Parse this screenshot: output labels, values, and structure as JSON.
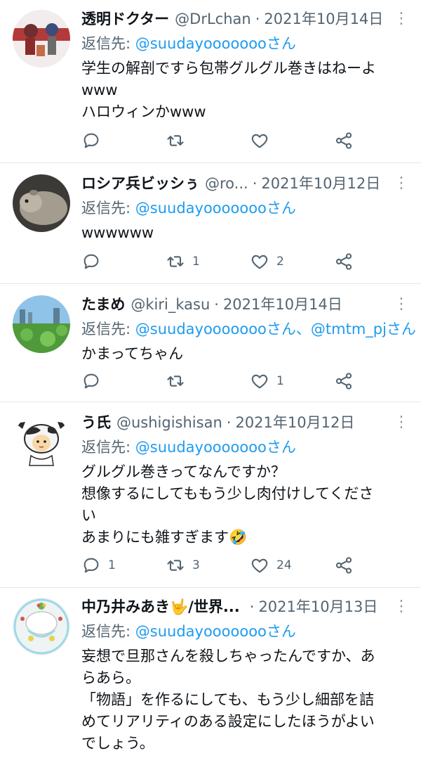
{
  "tweets": [
    {
      "name": "透明ドクター",
      "handle": "@DrLchan",
      "date": "2021年10月14日",
      "reply_prefix": "返信先: ",
      "reply_to": "@suudayoooooooさん",
      "body": "学生の解剖ですら包帯グルグル巻きはねーよ\nwww\nハロウィンかwww",
      "counts": {
        "reply": "",
        "retweet": "",
        "like": ""
      },
      "avatar": "avatar-image"
    },
    {
      "name": "ロシア兵ビッシぅ",
      "handle": "@ro...",
      "date": "2021年10月12日",
      "reply_prefix": "返信先: ",
      "reply_to": "@suudayoooooooさん",
      "body": "wwwwww",
      "counts": {
        "reply": "",
        "retweet": "1",
        "like": "2"
      },
      "avatar": "avatar-image"
    },
    {
      "name": "たまめ",
      "handle": "@kiri_kasu",
      "date": "2021年10月14日",
      "reply_prefix": "返信先: ",
      "reply_to": "@suudayoooooooさん、@tmtm_pjさん",
      "body": "かまってちゃん",
      "counts": {
        "reply": "",
        "retweet": "",
        "like": "1"
      },
      "avatar": "avatar-image"
    },
    {
      "name": "う氏",
      "handle": "@ushigishisan",
      "date": "2021年10月12日",
      "reply_prefix": "返信先: ",
      "reply_to": "@suudayoooooooさん",
      "body": "グルグル巻きってなんですか？\n想像するにしてももう少し肉付けしてくださ\nい\nあまりにも雑すぎます🤣",
      "counts": {
        "reply": "1",
        "retweet": "3",
        "like": "24"
      },
      "avatar": "avatar-image"
    },
    {
      "name": "中乃井みあき🤟/世界...",
      "handle": "",
      "date": "2021年10月13日",
      "reply_prefix": "返信先: ",
      "reply_to": "@suudayoooooooさん",
      "body": "妄想で旦那さんを殺しちゃったんですか、あ\nらあら。\n「物語」を作るにしても、もう少し細部を詰\nめてリアリティのある設定にしたほうがよい\nでしょう。",
      "counts": {
        "reply": "",
        "retweet": "",
        "like": ""
      },
      "avatar": "avatar-image"
    }
  ],
  "icons": {
    "more": "more-options-icon",
    "reply": "reply-icon",
    "retweet": "retweet-icon",
    "like": "like-icon",
    "share": "share-icon"
  },
  "colors": {
    "link": "#1d9bf0",
    "muted": "#536471",
    "divider": "#e3e6e8"
  }
}
